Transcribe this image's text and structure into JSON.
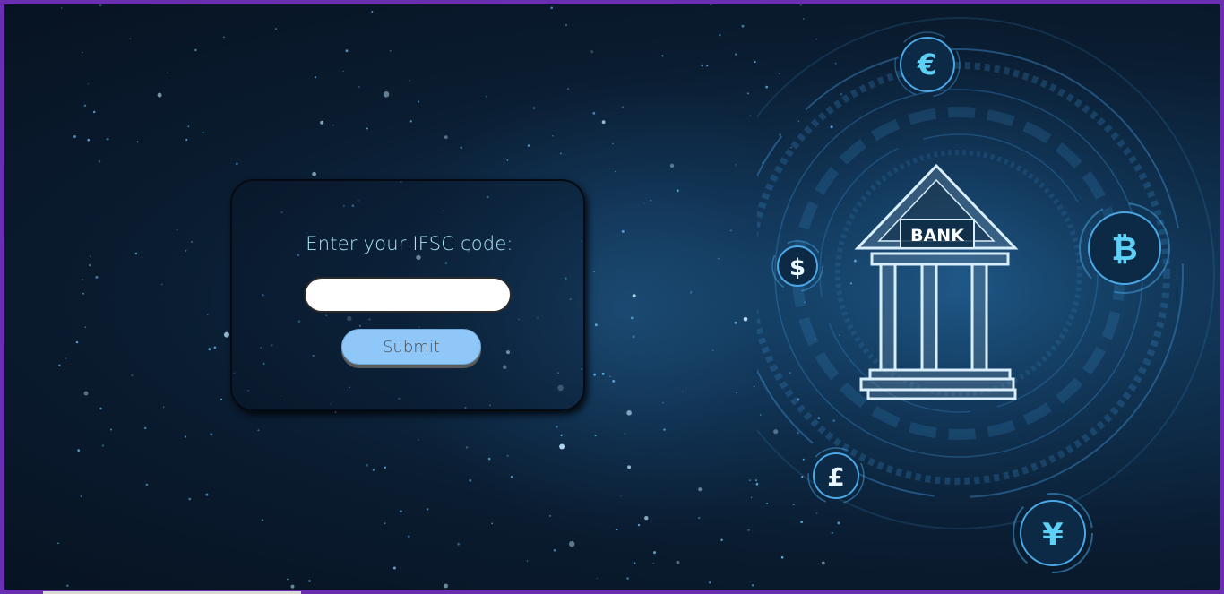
{
  "form": {
    "prompt": "Enter your IFSC code:",
    "input_value": "",
    "input_placeholder": "",
    "submit_label": "Submit"
  },
  "illustration": {
    "bank_sign": "BANK",
    "currency_symbols": [
      "€",
      "₿",
      "$",
      "£",
      "¥"
    ]
  },
  "colors": {
    "frame_border": "#6a2fb0",
    "prompt_text": "#a8e8f5",
    "submit_background": "#8fc8f8",
    "background_dark": "#0a1c30"
  }
}
